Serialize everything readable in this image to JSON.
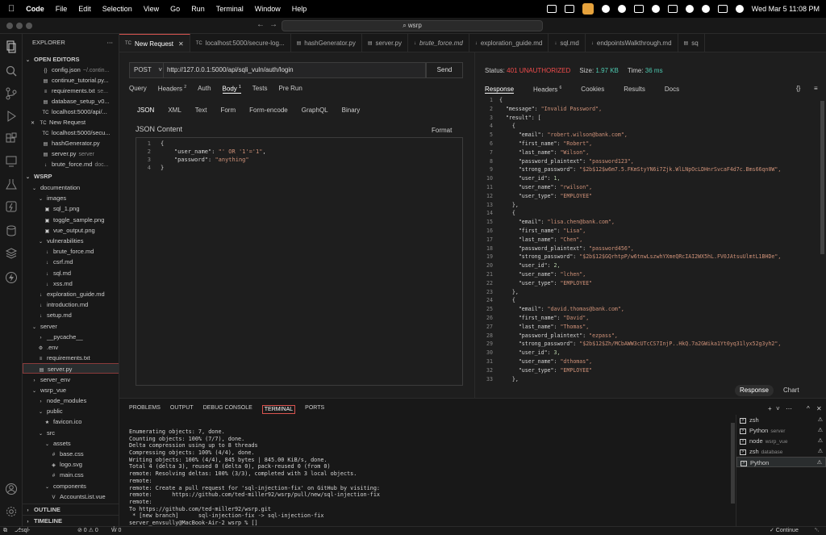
{
  "menubar": {
    "app": "Code",
    "items": [
      "File",
      "Edit",
      "Selection",
      "View",
      "Go",
      "Run",
      "Terminal",
      "Window",
      "Help"
    ],
    "datetime": "Wed Mar 5  11:08 PM"
  },
  "titlebar": {
    "search": "⌕ wsrp"
  },
  "explorer": {
    "header": "EXPLORER",
    "open_editors_header": "OPEN EDITORS",
    "open_editors": [
      {
        "icon": "{}",
        "name": "config.json",
        "desc": "~/.contin..."
      },
      {
        "icon": "▤",
        "name": "continue_tutorial.py...",
        "desc": ""
      },
      {
        "icon": "≡",
        "name": "requirements.txt",
        "desc": "se..."
      },
      {
        "icon": "▤",
        "name": "database_setup_v0...",
        "desc": ""
      },
      {
        "icon": "TC",
        "name": "localhost:5000/api/...",
        "desc": ""
      },
      {
        "icon": "TC",
        "name": "New Request",
        "desc": "",
        "close": "✕"
      },
      {
        "icon": "TC",
        "name": "localhost:5000/secu...",
        "desc": ""
      },
      {
        "icon": "▤",
        "name": "hashGenerator.py",
        "desc": ""
      },
      {
        "icon": "▤",
        "name": "server.py",
        "desc": "server"
      },
      {
        "icon": "↓",
        "name": "brute_force.md",
        "desc": "doc..."
      }
    ],
    "project_header": "WSRP",
    "tree": [
      {
        "indent": 1,
        "chev": "⌄",
        "icon": "",
        "name": "documentation"
      },
      {
        "indent": 2,
        "chev": "⌄",
        "icon": "",
        "name": "images"
      },
      {
        "indent": 3,
        "chev": "",
        "icon": "▣",
        "name": "sql_1.png"
      },
      {
        "indent": 3,
        "chev": "",
        "icon": "▣",
        "name": "toggle_sample.png"
      },
      {
        "indent": 3,
        "chev": "",
        "icon": "▣",
        "name": "vue_output.png"
      },
      {
        "indent": 2,
        "chev": "⌄",
        "icon": "",
        "name": "vulnerabilities"
      },
      {
        "indent": 3,
        "chev": "",
        "icon": "↓",
        "name": "brute_force.md"
      },
      {
        "indent": 3,
        "chev": "",
        "icon": "↓",
        "name": "csrf.md"
      },
      {
        "indent": 3,
        "chev": "",
        "icon": "↓",
        "name": "sql.md"
      },
      {
        "indent": 3,
        "chev": "",
        "icon": "↓",
        "name": "xss.md"
      },
      {
        "indent": 2,
        "chev": "",
        "icon": "↓",
        "name": "exploration_guide.md"
      },
      {
        "indent": 2,
        "chev": "",
        "icon": "↓",
        "name": "introduction.md"
      },
      {
        "indent": 2,
        "chev": "",
        "icon": "↓",
        "name": "setup.md"
      },
      {
        "indent": 1,
        "chev": "⌄",
        "icon": "",
        "name": "server"
      },
      {
        "indent": 2,
        "chev": "›",
        "icon": "",
        "name": "__pycache__"
      },
      {
        "indent": 2,
        "chev": "",
        "icon": "⚙",
        "name": ".env"
      },
      {
        "indent": 2,
        "chev": "",
        "icon": "≡",
        "name": "requirements.txt"
      },
      {
        "indent": 2,
        "chev": "",
        "icon": "▤",
        "name": "server.py",
        "selected": true
      },
      {
        "indent": 1,
        "chev": "›",
        "icon": "",
        "name": "server_env"
      },
      {
        "indent": 1,
        "chev": "⌄",
        "icon": "",
        "name": "wsrp_vue"
      },
      {
        "indent": 2,
        "chev": "›",
        "icon": "",
        "name": "node_modules"
      },
      {
        "indent": 2,
        "chev": "⌄",
        "icon": "",
        "name": "public"
      },
      {
        "indent": 3,
        "chev": "",
        "icon": "★",
        "name": "favicon.ico"
      },
      {
        "indent": 2,
        "chev": "⌄",
        "icon": "",
        "name": "src"
      },
      {
        "indent": 3,
        "chev": "⌄",
        "icon": "",
        "name": "assets"
      },
      {
        "indent": 4,
        "chev": "",
        "icon": "#",
        "name": "base.css"
      },
      {
        "indent": 4,
        "chev": "",
        "icon": "◈",
        "name": "logo.svg"
      },
      {
        "indent": 4,
        "chev": "",
        "icon": "#",
        "name": "main.css"
      },
      {
        "indent": 3,
        "chev": "⌄",
        "icon": "",
        "name": "components"
      },
      {
        "indent": 4,
        "chev": "",
        "icon": "V",
        "name": "AccountsList.vue"
      }
    ],
    "outline": "OUTLINE",
    "timeline": "TIMELINE"
  },
  "tabs": [
    {
      "icon": "TC",
      "label": "New Request",
      "active": true,
      "close": "✕"
    },
    {
      "icon": "TC",
      "label": "localhost:5000/secure-log..."
    },
    {
      "icon": "▤",
      "label": "hashGenerator.py"
    },
    {
      "icon": "▤",
      "label": "server.py"
    },
    {
      "icon": "↓",
      "label": "brute_force.md",
      "italic": true
    },
    {
      "icon": "↓",
      "label": "exploration_guide.md"
    },
    {
      "icon": "↓",
      "label": "sql.md"
    },
    {
      "icon": "↓",
      "label": "endpointsWalkthrough.md"
    },
    {
      "icon": "▤",
      "label": "sq"
    }
  ],
  "request": {
    "method": "POST",
    "method_arrow": "˅",
    "url": "http://127.0.0.1:5000/api/sqli_vuln/auth/login",
    "send": "Send",
    "tabs": [
      "Query",
      "Headers",
      "Auth",
      "Body",
      "Tests",
      "Pre Run"
    ],
    "headers_count": "2",
    "body_count": "1",
    "body_tabs": [
      "JSON",
      "XML",
      "Text",
      "Form",
      "Form-encode",
      "GraphQL",
      "Binary"
    ],
    "content_label": "JSON Content",
    "format": "Format",
    "code": [
      {
        "n": "1",
        "text": "{"
      },
      {
        "n": "2",
        "key": "    \"user_name\": ",
        "val": "\"' OR '1'='1\"",
        "end": ","
      },
      {
        "n": "3",
        "key": "    \"password\": ",
        "val": "\"anything\"",
        "end": ""
      },
      {
        "n": "4",
        "text": "}"
      }
    ]
  },
  "response": {
    "status_label": "Status:",
    "status": "401 UNAUTHORIZED",
    "size_label": "Size:",
    "size": "1.97 KB",
    "time_label": "Time:",
    "time": "36 ms",
    "tabs": [
      "Response",
      "Headers",
      "Cookies",
      "Results",
      "Docs"
    ],
    "headers_count": "6",
    "braces": "{}",
    "menu": "≡",
    "lines": [
      "{",
      "  \"message\": \"Invalid Password\",",
      "  \"result\": [",
      "    {",
      "      \"email\": \"robert.wilson@bank.com\",",
      "      \"first_name\": \"Robert\",",
      "      \"last_name\": \"Wilson\",",
      "      \"password_plaintext\": \"password123\",",
      "      \"strong_password\": \"$2b$12$w6m7.5.FKmStyYN6i7Zjk.WlLNpOcLDHnrSvcaF4d7c.Bms66qn0W\",",
      "      \"user_id\": 1,",
      "      \"user_name\": \"rwilson\",",
      "      \"user_type\": \"EMPLOYEE\"",
      "    },",
      "    {",
      "      \"email\": \"lisa.chen@bank.com\",",
      "      \"first_name\": \"Lisa\",",
      "      \"last_name\": \"Chen\",",
      "      \"password_plaintext\": \"password456\",",
      "      \"strong_password\": \"$2b$12$GQrhtpP/w6tnwLszwhYXmeQRcIAI2WX5hL.FV0JAtsuUlmtL1BHDe\",",
      "      \"user_id\": 2,",
      "      \"user_name\": \"lchen\",",
      "      \"user_type\": \"EMPLOYEE\"",
      "    },",
      "    {",
      "      \"email\": \"david.thomas@bank.com\",",
      "      \"first_name\": \"David\",",
      "      \"last_name\": \"Thomas\",",
      "      \"password_plaintext\": \"ezpass\",",
      "      \"strong_password\": \"$2b$12$Zh/MCbAWW3cUTcCS7InjP..HkQ.7a2GWika1Yt0yq31lyx52g3yh2\",",
      "      \"user_id\": 3,",
      "      \"user_name\": \"dthomas\",",
      "      \"user_type\": \"EMPLOYEE\"",
      "    },"
    ],
    "response_btn": "Response",
    "chart_btn": "Chart"
  },
  "terminal": {
    "tabs": [
      "PROBLEMS",
      "OUTPUT",
      "DEBUG CONSOLE",
      "TERMINAL",
      "PORTS"
    ],
    "active_tab": "TERMINAL",
    "icons": [
      "+",
      "˅",
      "⋯",
      "…",
      "^",
      "✕"
    ],
    "lines": [
      "Enumerating objects: 7, done.",
      "Counting objects: 100% (7/7), done.",
      "Delta compression using up to 8 threads",
      "Compressing objects: 100% (4/4), done.",
      "Writing objects: 100% (4/4), 845 bytes | 845.00 KiB/s, done.",
      "Total 4 (delta 3), reused 0 (delta 0), pack-reused 0 (from 0)",
      "remote: Resolving deltas: 100% (3/3), completed with 3 local objects.",
      "remote:",
      "remote: Create a pull request for 'sql-injection-fix' on GitHub by visiting:",
      "remote:      https://github.com/ted-miller92/wsrp/pull/new/sql-injection-fix",
      "remote:",
      "To https://github.com/ted-miller92/wsrp.git",
      " * [new branch]      sql-injection-fix -> sql-injection-fix",
      "server_envsully@MacBook-Air-2 wsrp % []"
    ],
    "sessions": [
      {
        "name": "zsh",
        "desc": ""
      },
      {
        "name": "Python",
        "desc": "server"
      },
      {
        "name": "node",
        "desc": "wsrp_vue"
      },
      {
        "name": "zsh",
        "desc": "database"
      },
      {
        "name": "Python",
        "desc": "",
        "selected": true
      }
    ],
    "warn": "⚠"
  },
  "statusbar": {
    "branch": "sql-injection-fix",
    "sync": "⊘ 0 ⚠ 0",
    "ports": "Ŵ 0",
    "continue": "✓ Continue",
    "bell": "␇"
  }
}
